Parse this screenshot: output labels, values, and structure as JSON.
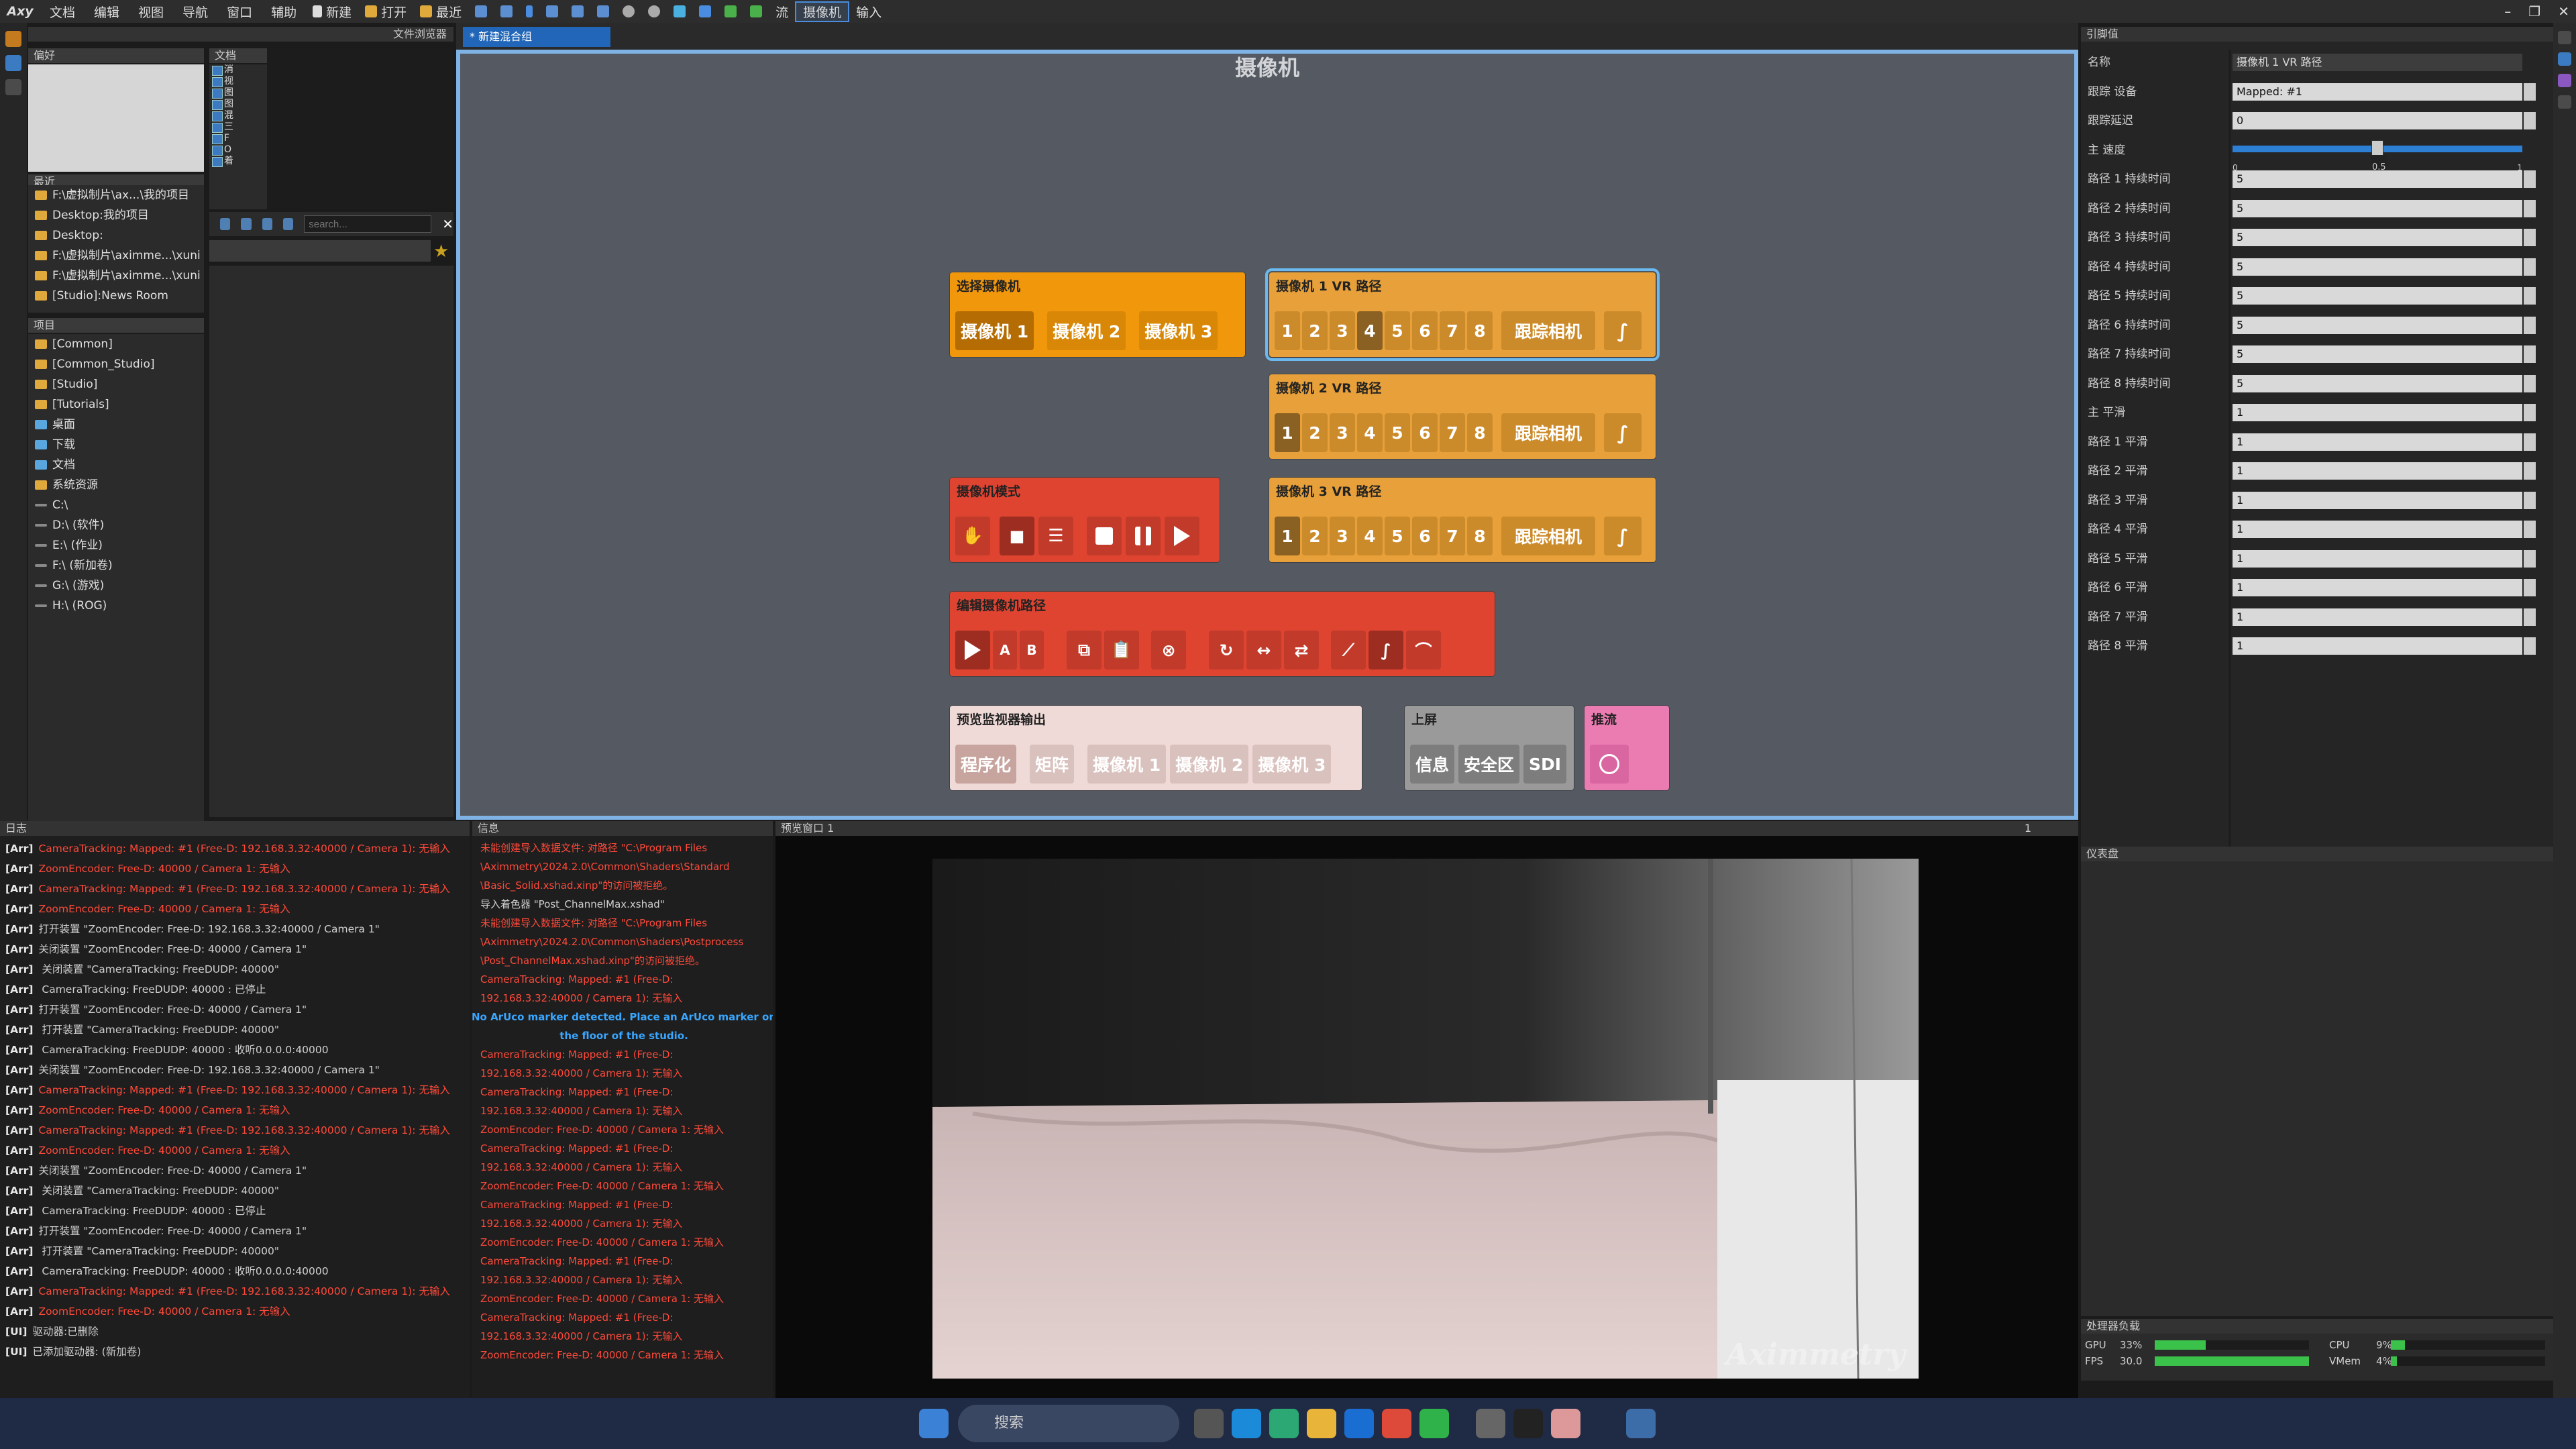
{
  "menubar": {
    "logo": "Axy",
    "menus": [
      "文档",
      "编辑",
      "视图",
      "导航",
      "窗口",
      "辅助"
    ],
    "tools": [
      "新建",
      "打开",
      "最近"
    ],
    "modes": [
      "流",
      "摄像机",
      "输入"
    ]
  },
  "panels": {
    "file_browser_title": "文件浏览器",
    "favorites": "偏好",
    "documents": "文档",
    "recent": "最近",
    "projects": "项目",
    "log": "日志",
    "info": "信息",
    "preview": "预览窗口 1",
    "preview_num": "1",
    "properties": "引脚值",
    "instrument": "仪表盘",
    "perf": "处理器负载"
  },
  "doc_items": [
    "消",
    "视",
    "图",
    "图",
    "混",
    "三",
    "F",
    "O",
    "着"
  ],
  "search_placeholder": "search...",
  "recent_items": [
    "F:\\虚拟制片\\ax...\\我的项目",
    "Desktop:我的项目",
    "Desktop:",
    "F:\\虚拟制片\\aximme...\\xuni",
    "F:\\虚拟制片\\aximme...\\xuni",
    "[Studio]:News Room"
  ],
  "project_items": [
    "[Common]",
    "[Common_Studio]",
    "[Studio]",
    "[Tutorials]",
    "桌面",
    "下载",
    "文档",
    "系统资源",
    "C:\\",
    "D:\\ (软件)",
    "E:\\ (作业)",
    "F:\\ (新加卷)",
    "G:\\ (游戏)",
    "H:\\ (ROG)"
  ],
  "tab": {
    "label": "* 新建混合组"
  },
  "canvas": {
    "title": "摄像机",
    "select_camera": {
      "title": "选择摄像机",
      "buttons": [
        "摄像机 1",
        "摄像机 2",
        "摄像机 3"
      ]
    },
    "vr_paths": [
      {
        "title": "摄像机 1 VR 路径",
        "nums": [
          "1",
          "2",
          "3",
          "4",
          "5",
          "6",
          "7",
          "8"
        ],
        "track": "跟踪相机"
      },
      {
        "title": "摄像机 2 VR 路径",
        "nums": [
          "1",
          "2",
          "3",
          "4",
          "5",
          "6",
          "7",
          "8"
        ],
        "track": "跟踪相机"
      },
      {
        "title": "摄像机 3 VR 路径",
        "nums": [
          "1",
          "2",
          "3",
          "4",
          "5",
          "6",
          "7",
          "8"
        ],
        "track": "跟踪相机"
      }
    ],
    "camera_mode": {
      "title": "摄像机模式"
    },
    "edit_path": {
      "title": "编辑摄像机路径",
      "a": "A",
      "b": "B"
    },
    "preview_out": {
      "title": "预览监视器输出",
      "buttons": [
        "程序化",
        "矩阵",
        "摄像机 1",
        "摄像机 2",
        "摄像机 3"
      ]
    },
    "upper": {
      "title": "上屏",
      "buttons": [
        "信息",
        "安全区",
        "SDI"
      ]
    },
    "push": {
      "title": "推流"
    }
  },
  "properties": [
    {
      "label": "名称",
      "value": "摄像机 1 VR 路径",
      "style": "dark"
    },
    {
      "label": "跟踪 设备",
      "value": "Mapped: #1"
    },
    {
      "label": "跟踪延迟",
      "value": "0"
    },
    {
      "label": "主 速度",
      "value": "0.5"
    },
    {
      "label": "路径 1 持续时间",
      "value": "5"
    },
    {
      "label": "路径 2 持续时间",
      "value": "5"
    },
    {
      "label": "路径 3 持续时间",
      "value": "5"
    },
    {
      "label": "路径 4 持续时间",
      "value": "5"
    },
    {
      "label": "路径 5 持续时间",
      "value": "5"
    },
    {
      "label": "路径 6 持续时间",
      "value": "5"
    },
    {
      "label": "路径 7 持续时间",
      "value": "5"
    },
    {
      "label": "路径 8 持续时间",
      "value": "5"
    },
    {
      "label": "主 平滑",
      "value": "1"
    },
    {
      "label": "路径 1 平滑",
      "value": "1"
    },
    {
      "label": "路径 2 平滑",
      "value": "1"
    },
    {
      "label": "路径 3 平滑",
      "value": "1"
    },
    {
      "label": "路径 4 平滑",
      "value": "1"
    },
    {
      "label": "路径 5 平滑",
      "value": "1"
    },
    {
      "label": "路径 6 平滑",
      "value": "1"
    },
    {
      "label": "路径 7 平滑",
      "value": "1"
    },
    {
      "label": "路径 8 平滑",
      "value": "1"
    }
  ],
  "slider": {
    "min": "0",
    "max": "1",
    "value": 0.5
  },
  "log": [
    {
      "t": "[Arr]",
      "m": "CameraTracking: Mapped: #1 (Free-D: 192.168.3.32:40000 / Camera 1): 无输入",
      "e": true
    },
    {
      "t": "[Arr]",
      "m": "ZoomEncoder: Free-D: 40000 / Camera 1: 无输入",
      "e": true
    },
    {
      "t": "[Arr]",
      "m": "CameraTracking: Mapped: #1 (Free-D: 192.168.3.32:40000 / Camera 1): 无输入",
      "e": true
    },
    {
      "t": "[Arr]",
      "m": "ZoomEncoder: Free-D: 40000 / Camera 1: 无输入",
      "e": true
    },
    {
      "t": "[Arr]",
      "m": "打开装置 \"ZoomEncoder: Free-D: 192.168.3.32:40000 / Camera 1\"",
      "e": false
    },
    {
      "t": "[Arr]",
      "m": "关闭装置 \"ZoomEncoder: Free-D: 40000 / Camera 1\"",
      "e": false
    },
    {
      "t": "[Arr]",
      "m": "   关闭装置 \"CameraTracking: FreeDUDP: 40000\"",
      "e": false
    },
    {
      "t": "[Arr]",
      "m": "      CameraTracking: FreeDUDP: 40000 : 已停止",
      "e": false
    },
    {
      "t": "[Arr]",
      "m": "打开装置 \"ZoomEncoder: Free-D: 40000 / Camera 1\"",
      "e": false
    },
    {
      "t": "[Arr]",
      "m": "   打开装置 \"CameraTracking: FreeDUDP: 40000\"",
      "e": false
    },
    {
      "t": "[Arr]",
      "m": "      CameraTracking: FreeDUDP: 40000 : 收听0.0.0.0:40000",
      "e": false
    },
    {
      "t": "[Arr]",
      "m": "关闭装置 \"ZoomEncoder: Free-D: 192.168.3.32:40000 / Camera 1\"",
      "e": false
    },
    {
      "t": "[Arr]",
      "m": "CameraTracking: Mapped: #1 (Free-D: 192.168.3.32:40000 / Camera 1): 无输入",
      "e": true
    },
    {
      "t": "[Arr]",
      "m": "ZoomEncoder: Free-D: 40000 / Camera 1: 无输入",
      "e": true
    },
    {
      "t": "[Arr]",
      "m": "CameraTracking: Mapped: #1 (Free-D: 192.168.3.32:40000 / Camera 1): 无输入",
      "e": true
    },
    {
      "t": "[Arr]",
      "m": "ZoomEncoder: Free-D: 40000 / Camera 1: 无输入",
      "e": true
    },
    {
      "t": "[Arr]",
      "m": "关闭装置 \"ZoomEncoder: Free-D: 40000 / Camera 1\"",
      "e": false
    },
    {
      "t": "[Arr]",
      "m": "   关闭装置 \"CameraTracking: FreeDUDP: 40000\"",
      "e": false
    },
    {
      "t": "[Arr]",
      "m": "      CameraTracking: FreeDUDP: 40000 : 已停止",
      "e": false
    },
    {
      "t": "[Arr]",
      "m": "打开装置 \"ZoomEncoder: Free-D: 40000 / Camera 1\"",
      "e": false
    },
    {
      "t": "[Arr]",
      "m": "   打开装置 \"CameraTracking: FreeDUDP: 40000\"",
      "e": false
    },
    {
      "t": "[Arr]",
      "m": "      CameraTracking: FreeDUDP: 40000 : 收听0.0.0.0:40000",
      "e": false
    },
    {
      "t": "[Arr]",
      "m": "CameraTracking: Mapped: #1 (Free-D: 192.168.3.32:40000 / Camera 1): 无输入",
      "e": true
    },
    {
      "t": "[Arr]",
      "m": "ZoomEncoder: Free-D: 40000 / Camera 1: 无输入",
      "e": true
    },
    {
      "t": "[UI]",
      "m": "驱动器:已删除",
      "e": false
    },
    {
      "t": "[UI]",
      "m": "已添加驱动器: (新加卷)",
      "e": false
    }
  ],
  "info": [
    {
      "c": "e",
      "m": "   未能创建导入数据文件: 对路径 \"C:\\Program Files"
    },
    {
      "c": "e",
      "m": "\\Aximmetry\\2024.2.0\\Common\\Shaders\\Standard"
    },
    {
      "c": "e",
      "m": "\\Basic_Solid.xshad.xinp\"的访问被拒绝。"
    },
    {
      "c": "w",
      "m": "导入着色器 \"Post_ChannelMax.xshad\""
    },
    {
      "c": "e",
      "m": "   未能创建导入数据文件: 对路径 \"C:\\Program Files"
    },
    {
      "c": "e",
      "m": "\\Aximmetry\\2024.2.0\\Common\\Shaders\\Postprocess"
    },
    {
      "c": "e",
      "m": "\\Post_ChannelMax.xshad.xinp\"的访问被拒绝。"
    },
    {
      "c": "e",
      "m": "CameraTracking: Mapped: #1 (Free-D:"
    },
    {
      "c": "e",
      "m": "192.168.3.32:40000 / Camera 1): 无输入"
    },
    {
      "c": "b",
      "m": "No ArUco marker detected. Place an ArUco marker on"
    },
    {
      "c": "b",
      "m": "the floor of the studio."
    },
    {
      "c": "e",
      "m": "CameraTracking: Mapped: #1 (Free-D:"
    },
    {
      "c": "e",
      "m": "192.168.3.32:40000 / Camera 1): 无输入"
    },
    {
      "c": "e",
      "m": "CameraTracking: Mapped: #1 (Free-D:"
    },
    {
      "c": "e",
      "m": "192.168.3.32:40000 / Camera 1): 无输入"
    },
    {
      "c": "e",
      "m": "ZoomEncoder: Free-D: 40000 / Camera 1: 无输入"
    },
    {
      "c": "e",
      "m": "CameraTracking: Mapped: #1 (Free-D:"
    },
    {
      "c": "e",
      "m": "192.168.3.32:40000 / Camera 1): 无输入"
    },
    {
      "c": "e",
      "m": "ZoomEncoder: Free-D: 40000 / Camera 1: 无输入"
    },
    {
      "c": "e",
      "m": "CameraTracking: Mapped: #1 (Free-D:"
    },
    {
      "c": "e",
      "m": "192.168.3.32:40000 / Camera 1): 无输入"
    },
    {
      "c": "e",
      "m": "ZoomEncoder: Free-D: 40000 / Camera 1: 无输入"
    },
    {
      "c": "e",
      "m": "CameraTracking: Mapped: #1 (Free-D:"
    },
    {
      "c": "e",
      "m": "192.168.3.32:40000 / Camera 1): 无输入"
    },
    {
      "c": "e",
      "m": "ZoomEncoder: Free-D: 40000 / Camera 1: 无输入"
    },
    {
      "c": "e",
      "m": "CameraTracking: Mapped: #1 (Free-D:"
    },
    {
      "c": "e",
      "m": "192.168.3.32:40000 / Camera 1): 无输入"
    },
    {
      "c": "e",
      "m": "ZoomEncoder: Free-D: 40000 / Camera 1: 无输入"
    }
  ],
  "preview": {
    "watermark": "Aximmetry"
  },
  "perf": {
    "gpu_label": "GPU",
    "gpu_pct": "33%",
    "gpu_val": 0.33,
    "fps_label": "FPS",
    "fps": "30.0",
    "fps_val": 1.0,
    "cpu_label": "CPU",
    "cpu_pct": "9%",
    "cpu_val": 0.09,
    "vmem_label": "VMem",
    "vmem_pct": "4%",
    "vmem_val": 0.04
  },
  "taskbar": {
    "search": "搜索"
  },
  "colors": {
    "accent": "#2166b8",
    "orange": "#f0970c",
    "red": "#df4431",
    "error": "#ff4a3a"
  }
}
